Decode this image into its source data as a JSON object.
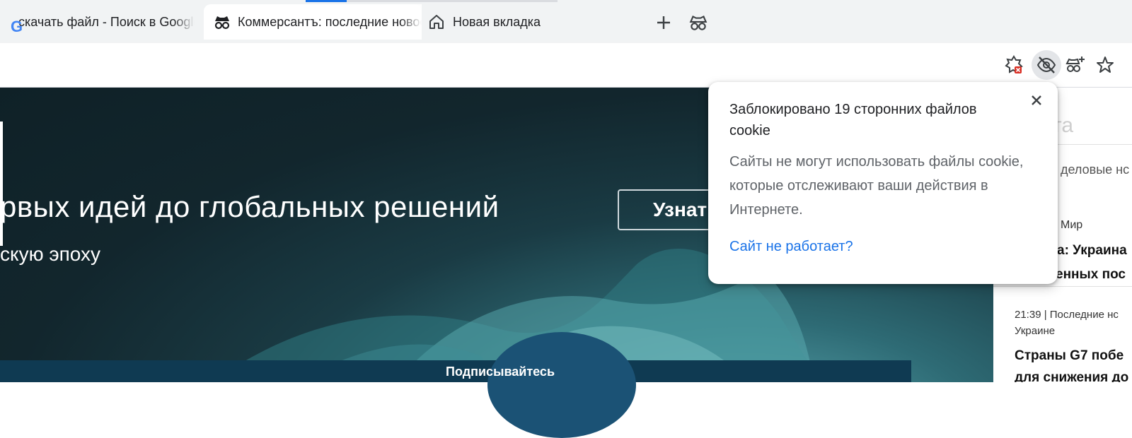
{
  "tabs": [
    {
      "title": "скачать файл - Поиск в Google",
      "icon": "google-icon",
      "active": false
    },
    {
      "title": "Коммерсантъ: последние новости",
      "icon": "incognito-icon",
      "active": true
    },
    {
      "title": "Новая вкладка",
      "icon": "home-icon",
      "active": false
    }
  ],
  "tabstrip": {
    "new_tab_icon": "plus-icon",
    "incognito_icon": "incognito-icon"
  },
  "toolbar": {
    "icons": [
      "extension-error-icon",
      "eye-blocked-icon",
      "incognito-plus-icon",
      "star-icon"
    ]
  },
  "page": {
    "hero_title": "рвых идей до глобальных решений",
    "hero_sub": "скую эпоху",
    "learn_button": "Узнат",
    "subscribe": "Подписывайтесь",
    "sidebar": {
      "search_placeholder": "та",
      "desc": "деловые нс",
      "cat": "Мир",
      "headline1": "а: Украина",
      "headline2": "енных пос",
      "time": "21:39  |  Последние нс",
      "time_cont": "Украине",
      "headline3": "Страны G7 побе",
      "headline4": "для снижения до"
    }
  },
  "popup": {
    "title": "Заблокировано 19 сторонних файлов cookie",
    "body": "Сайты не могут использовать файлы cookie, которые отслеживают ваши действия в Интернете.",
    "link": "Сайт не работает?",
    "close_icon": "close-icon"
  },
  "colors": {
    "accent": "#1a73e8",
    "hero_bg": "#12262d",
    "bottombar": "#0f3a52"
  }
}
